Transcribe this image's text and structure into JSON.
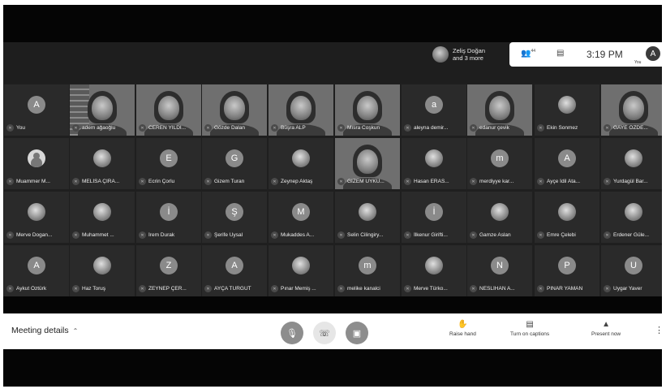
{
  "header": {
    "presenter_line1": "Zeliş Doğan",
    "presenter_line2": "and 3 more",
    "people_icon": "people-icon",
    "people_count": "44",
    "chat_icon": "chat-icon",
    "time": "3:19 PM",
    "me_initial": "A",
    "me_label": "You"
  },
  "participants": [
    {
      "name": "You",
      "initial": "A",
      "kind": "letter"
    },
    {
      "name": "adem ağaoğlu",
      "initial": "",
      "kind": "video"
    },
    {
      "name": "CEREN YILDI...",
      "initial": "",
      "kind": "video"
    },
    {
      "name": "Gözde Dalan",
      "initial": "",
      "kind": "video"
    },
    {
      "name": "Büşra ALP",
      "initial": "",
      "kind": "video"
    },
    {
      "name": "Mısra Coşkun",
      "initial": "",
      "kind": "video"
    },
    {
      "name": "aleyna demir...",
      "initial": "a",
      "kind": "letter"
    },
    {
      "name": "edanur çevik",
      "initial": "",
      "kind": "video"
    },
    {
      "name": "Ekin Sonmez",
      "initial": "",
      "kind": "photo"
    },
    {
      "name": "GAYE ÖZDE...",
      "initial": "",
      "kind": "video"
    },
    {
      "name": "Muammer M...",
      "initial": "",
      "kind": "person"
    },
    {
      "name": "MELİSA ÇIRA...",
      "initial": "",
      "kind": "photo"
    },
    {
      "name": "Ecrin Çorlu",
      "initial": "E",
      "kind": "letter"
    },
    {
      "name": "Gizem Turan",
      "initial": "G",
      "kind": "letter"
    },
    {
      "name": "Zeynep Aktaş",
      "initial": "",
      "kind": "photo"
    },
    {
      "name": "GİZEM UYKU...",
      "initial": "",
      "kind": "video"
    },
    {
      "name": "Hasan ERAS...",
      "initial": "",
      "kind": "photo"
    },
    {
      "name": "merdiyye kar...",
      "initial": "m",
      "kind": "letter"
    },
    {
      "name": "Ayçe İdil Ata...",
      "initial": "A",
      "kind": "letter"
    },
    {
      "name": "Yurdagül Bar...",
      "initial": "",
      "kind": "photo"
    },
    {
      "name": "Merve Dogan...",
      "initial": "",
      "kind": "photo"
    },
    {
      "name": "Muhammet ...",
      "initial": "",
      "kind": "photo"
    },
    {
      "name": "İrem Durak",
      "initial": "İ",
      "kind": "letter"
    },
    {
      "name": "Şerife Uysal",
      "initial": "Ş",
      "kind": "letter"
    },
    {
      "name": "Mukaddes A...",
      "initial": "M",
      "kind": "letter"
    },
    {
      "name": "Selin Cilingiry...",
      "initial": "",
      "kind": "photo"
    },
    {
      "name": "İlkenur Girifti...",
      "initial": "İ",
      "kind": "letter"
    },
    {
      "name": "Gamze Aslan",
      "initial": "",
      "kind": "photo"
    },
    {
      "name": "Emre Çelebi",
      "initial": "",
      "kind": "photo"
    },
    {
      "name": "Erdener Güle...",
      "initial": "",
      "kind": "photo"
    },
    {
      "name": "Aykut Öztürk",
      "initial": "A",
      "kind": "letter"
    },
    {
      "name": "Haz Toruş",
      "initial": "",
      "kind": "photo"
    },
    {
      "name": "ZEYNEP ÇER...",
      "initial": "Z",
      "kind": "letter"
    },
    {
      "name": "AYÇA TURĞUT",
      "initial": "A",
      "kind": "letter"
    },
    {
      "name": "Pınar Memiş ...",
      "initial": "",
      "kind": "photo"
    },
    {
      "name": "melike kanalci",
      "initial": "m",
      "kind": "letter"
    },
    {
      "name": "Merve Türko...",
      "initial": "",
      "kind": "photo"
    },
    {
      "name": "NESLİHAN A...",
      "initial": "N",
      "kind": "letter"
    },
    {
      "name": "PINAR YAMAN",
      "initial": "P",
      "kind": "letter"
    },
    {
      "name": "Uygar Yaver",
      "initial": "U",
      "kind": "letter"
    }
  ],
  "footer": {
    "meeting_details": "Meeting details",
    "caret_icon": "chevron-up-icon",
    "mic_icon": "mic-off-icon",
    "hangup_icon": "call-end-icon",
    "camera_icon": "camera-off-icon",
    "raise_hand": "Raise hand",
    "captions": "Turn on captions",
    "present": "Present now",
    "more_icon": "more-vert-icon"
  }
}
